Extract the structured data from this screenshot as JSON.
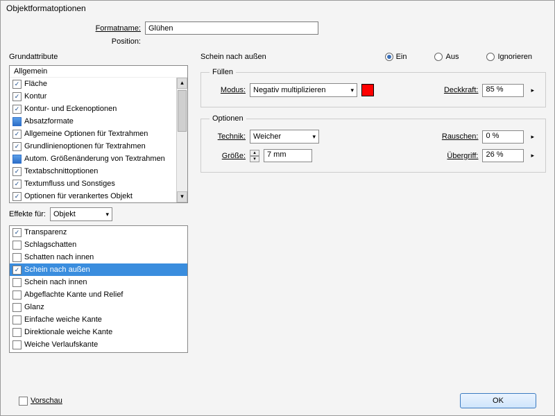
{
  "window": {
    "title": "Objektformatoptionen"
  },
  "form": {
    "formatname_label": "Formatname:",
    "formatname_value": "Glühen",
    "position_label": "Position:"
  },
  "left": {
    "grund_label": "Grundattribute",
    "allgemein": "Allgemein",
    "attrs": [
      {
        "label": "Fläche",
        "state": "checked"
      },
      {
        "label": "Kontur",
        "state": "checked"
      },
      {
        "label": "Kontur- und Eckenoptionen",
        "state": "checked"
      },
      {
        "label": "Absatzformate",
        "state": "box"
      },
      {
        "label": "Allgemeine Optionen für Textrahmen",
        "state": "checked"
      },
      {
        "label": "Grundlinienoptionen für Textrahmen",
        "state": "checked"
      },
      {
        "label": "Autom. Größenänderung von Textrahmen",
        "state": "box"
      },
      {
        "label": "Textabschnittoptionen",
        "state": "checked"
      },
      {
        "label": "Textumfluss und Sonstiges",
        "state": "checked"
      },
      {
        "label": "Optionen für verankertes Objekt",
        "state": "checked"
      }
    ],
    "effekte_label": "Effekte für:",
    "effekte_value": "Objekt",
    "effects": [
      {
        "label": "Transparenz",
        "state": "checked",
        "selected": false
      },
      {
        "label": "Schlagschatten",
        "state": "",
        "selected": false
      },
      {
        "label": "Schatten nach innen",
        "state": "",
        "selected": false
      },
      {
        "label": "Schein nach außen",
        "state": "checked",
        "selected": true
      },
      {
        "label": "Schein nach innen",
        "state": "",
        "selected": false
      },
      {
        "label": "Abgeflachte Kante und Relief",
        "state": "",
        "selected": false
      },
      {
        "label": "Glanz",
        "state": "",
        "selected": false
      },
      {
        "label": "Einfache weiche Kante",
        "state": "",
        "selected": false
      },
      {
        "label": "Direktionale weiche Kante",
        "state": "",
        "selected": false
      },
      {
        "label": "Weiche Verlaufskante",
        "state": "",
        "selected": false
      }
    ]
  },
  "right": {
    "panel_title": "Schein nach außen",
    "radio": {
      "ein": "Ein",
      "aus": "Aus",
      "ignorieren": "Ignorieren",
      "selected": "ein"
    },
    "fuellen": {
      "legend": "Füllen",
      "modus_label": "Modus:",
      "modus_value": "Negativ multiplizieren",
      "swatch": "#ff0000",
      "deckkraft_label": "Deckkraft:",
      "deckkraft_value": "85 %"
    },
    "optionen": {
      "legend": "Optionen",
      "technik_label": "Technik:",
      "technik_value": "Weicher",
      "groesse_label": "Größe:",
      "groesse_value": "7 mm",
      "rauschen_label": "Rauschen:",
      "rauschen_value": "0 %",
      "uebergriff_label": "Übergriff:",
      "uebergriff_value": "26 %"
    }
  },
  "bottom": {
    "vorschau": "Vorschau",
    "ok": "OK"
  }
}
